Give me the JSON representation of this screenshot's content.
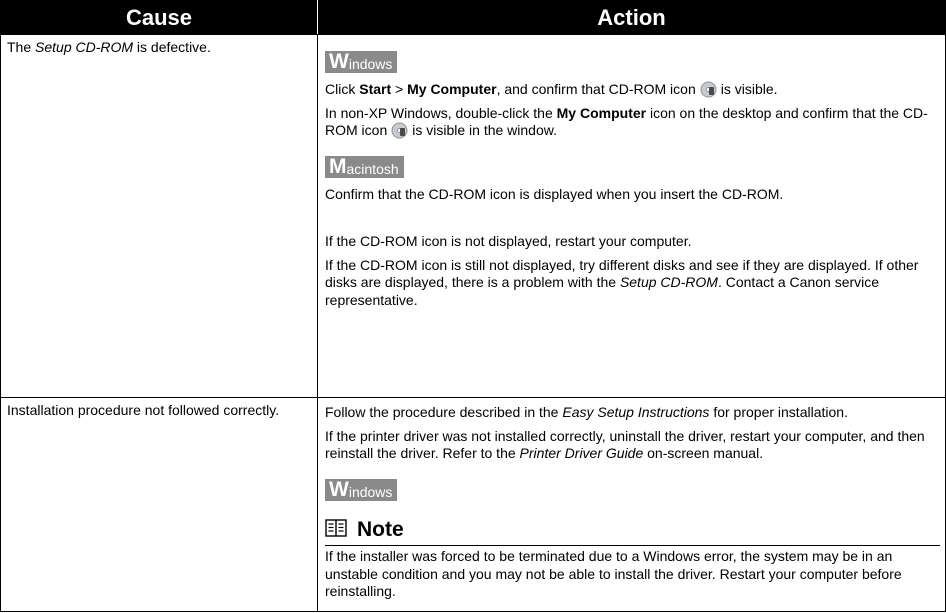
{
  "header": {
    "cause": "Cause",
    "action": "Action"
  },
  "row1": {
    "cause_pre": "The ",
    "cause_em": "Setup CD-ROM",
    "cause_post": " is defective.",
    "windows_badge": {
      "big": "W",
      "rest": "indows"
    },
    "win_p1": {
      "a": "Click ",
      "b": "Start",
      "c": " > ",
      "d": "My Computer",
      "e": ", and confirm that CD-ROM icon",
      "f": "is visible."
    },
    "win_p2": {
      "a": "In non-XP Windows, double-click the ",
      "b": "My Computer",
      "c": " icon on the desktop and confirm that the CD-ROM icon",
      "d": "is visible in the window."
    },
    "mac_badge": {
      "big": "M",
      "rest": "acintosh"
    },
    "mac_p1": "Confirm that the CD-ROM icon is displayed when you insert the CD-ROM.",
    "p_restart": "If the CD-ROM icon is not displayed, restart your computer.",
    "p_disks": {
      "a": "If the CD-ROM icon is still not displayed, try different disks and see if they are displayed. If other disks are displayed, there is a problem with the ",
      "b": "Setup CD-ROM",
      "c": ". Contact a Canon service representative."
    }
  },
  "row2": {
    "cause": "Installation procedure not followed correctly.",
    "p1": {
      "a": "Follow the procedure described in the ",
      "b": "Easy Setup Instructions",
      "c": " for proper installation."
    },
    "p2": {
      "a": "If the printer driver was not installed correctly, uninstall the driver, restart your computer, and then reinstall the driver. Refer to the ",
      "b": "Printer Driver Guide",
      "c": " on-screen manual."
    },
    "windows_badge": {
      "big": "W",
      "rest": "indows"
    },
    "note_title": "Note",
    "note_text": "If the installer was forced to be terminated due to a Windows error, the system may be in an unstable condition and you may not be able to install the driver. Restart your computer before reinstalling."
  },
  "icons": {
    "cd": "cd-rom-icon",
    "note": "note-book-icon"
  }
}
